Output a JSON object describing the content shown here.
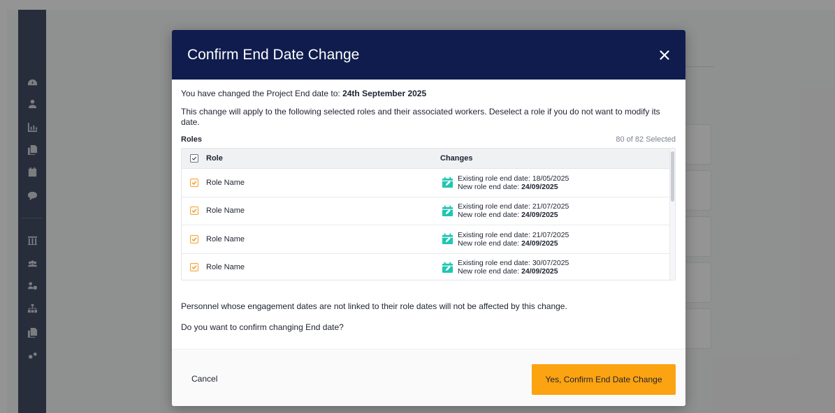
{
  "modal": {
    "title": "Confirm End Date Change",
    "intro_prefix": "You have changed the Project End date to:",
    "intro_date": "24th September 2025",
    "description": "This change will apply to the following selected roles and their associated workers. Deselect a role if you do not want to modify its date.",
    "roles_label": "Roles",
    "selected_count": "80 of 82 Selected",
    "table": {
      "headers": {
        "role": "Role",
        "changes": "Changes"
      },
      "rows": [
        {
          "role": "Role Name",
          "existing_label": "Existing role end date:",
          "existing_date": "18/05/2025",
          "new_label": "New role end date:",
          "new_date": "24/09/2025",
          "checked": true
        },
        {
          "role": "Role Name",
          "existing_label": "Existing role end date:",
          "existing_date": "21/07/2025",
          "new_label": "New role end date:",
          "new_date": "24/09/2025",
          "checked": true
        },
        {
          "role": "Role Name",
          "existing_label": "Existing role end date:",
          "existing_date": "21/07/2025",
          "new_label": "New role end date:",
          "new_date": "24/09/2025",
          "checked": true
        },
        {
          "role": "Role Name",
          "existing_label": "Existing role end date:",
          "existing_date": "30/07/2025",
          "new_label": "New role end date:",
          "new_date": "24/09/2025",
          "checked": true
        }
      ]
    },
    "note": "Personnel whose engagement dates are not linked to their role dates will not be affected by this change.",
    "question": "Do you want to confirm changing End date?",
    "cancel_label": "Cancel",
    "confirm_label": "Yes, Confirm End Date Change"
  },
  "colors": {
    "header_bg": "#0f1c4d",
    "confirm_bg": "#fca311",
    "calendar_icon": "#1fc6b2",
    "checkbox_accent": "#f4a43a"
  },
  "icons": {
    "close": "close-icon",
    "calendar": "calendar-edit-icon",
    "checkbox": "checkbox-checked-icon"
  }
}
